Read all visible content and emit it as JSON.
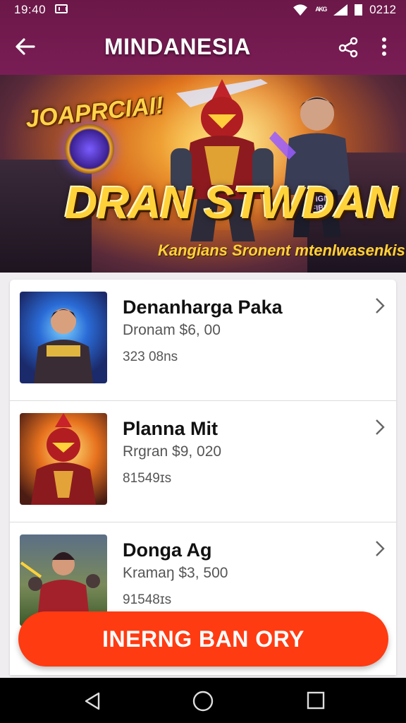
{
  "status_bar": {
    "time": "19:40",
    "right_text": "0212",
    "extra": "ᴬᴷᴳ"
  },
  "app_bar": {
    "title": "MINDANESIA",
    "icons": [
      "back-arrow-icon",
      "share-icon",
      "more-vert-icon"
    ]
  },
  "hero": {
    "tagline": "JOAPRCIAI!",
    "title": "DRAN STWDAN",
    "subtitle": "Kangians Sronent mtenlwasenkis",
    "badge": "NIGN FIBN"
  },
  "list": {
    "items": [
      {
        "title": "Denanharga Paka",
        "price": "Dronam $6, 00",
        "meta": "323 08ns"
      },
      {
        "title": "Planna Mit",
        "price": "Rrgran $9, 020",
        "meta": "81549ɪs"
      },
      {
        "title": "Donga Ag",
        "price": "Kramaŋ $3, 500",
        "meta": "91548ɪs"
      }
    ]
  },
  "cta": {
    "label": "INERNG BAN ORY",
    "color": "#ff3b12"
  },
  "colors": {
    "app_bar": "#6b1848",
    "accent": "#ff3b12"
  }
}
